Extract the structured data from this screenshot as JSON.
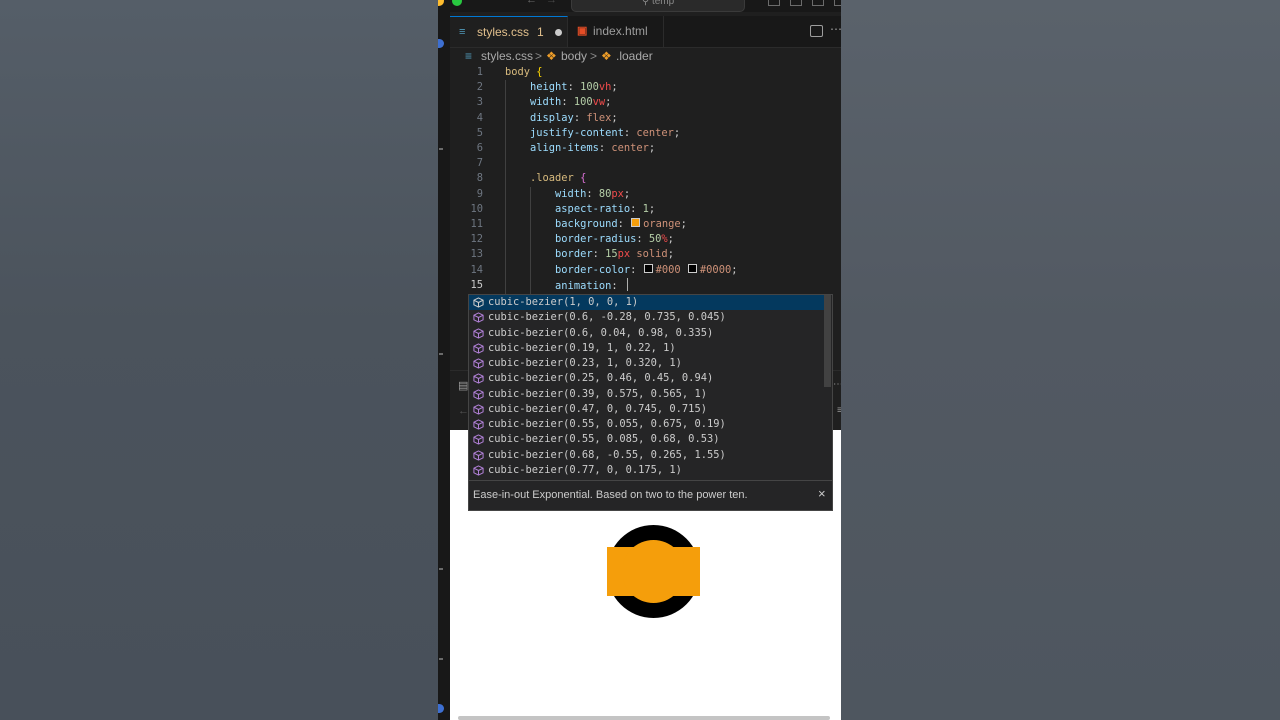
{
  "window": {
    "title_search": "temp"
  },
  "tabs": [
    {
      "label": "styles.css",
      "badge": "1",
      "icon": "css-file-icon",
      "modified": true
    },
    {
      "label": "index.html",
      "icon": "html-file-icon",
      "modified": false
    }
  ],
  "breadcrumb": {
    "file": "styles.css",
    "sep1": ">",
    "sym1": "body",
    "sep2": ">",
    "sym2": ".loader"
  },
  "editor": {
    "lines": [
      {
        "n": "1",
        "tokens": [
          {
            "t": "body ",
            "c": "#d7ba7d"
          },
          {
            "t": "{",
            "c": "#ffd700"
          }
        ]
      },
      {
        "n": "2",
        "tokens": [
          {
            "t": "    height",
            "c": "#9cdcfe"
          },
          {
            "t": ": ",
            "c": "#cccccc"
          },
          {
            "t": "100",
            "c": "#b5cea8"
          },
          {
            "t": "vh",
            "c": "#f14c4c"
          },
          {
            "t": ";",
            "c": "#cccccc"
          }
        ]
      },
      {
        "n": "3",
        "tokens": [
          {
            "t": "    width",
            "c": "#9cdcfe"
          },
          {
            "t": ": ",
            "c": "#cccccc"
          },
          {
            "t": "100",
            "c": "#b5cea8"
          },
          {
            "t": "vw",
            "c": "#f14c4c"
          },
          {
            "t": ";",
            "c": "#cccccc"
          }
        ]
      },
      {
        "n": "4",
        "tokens": [
          {
            "t": "    display",
            "c": "#9cdcfe"
          },
          {
            "t": ": ",
            "c": "#cccccc"
          },
          {
            "t": "flex",
            "c": "#ce9178"
          },
          {
            "t": ";",
            "c": "#cccccc"
          }
        ]
      },
      {
        "n": "5",
        "tokens": [
          {
            "t": "    justify-content",
            "c": "#9cdcfe"
          },
          {
            "t": ": ",
            "c": "#cccccc"
          },
          {
            "t": "center",
            "c": "#ce9178"
          },
          {
            "t": ";",
            "c": "#cccccc"
          }
        ]
      },
      {
        "n": "6",
        "tokens": [
          {
            "t": "    align-items",
            "c": "#9cdcfe"
          },
          {
            "t": ": ",
            "c": "#cccccc"
          },
          {
            "t": "center",
            "c": "#ce9178"
          },
          {
            "t": ";",
            "c": "#cccccc"
          }
        ]
      },
      {
        "n": "7",
        "tokens": []
      },
      {
        "n": "8",
        "tokens": [
          {
            "t": "    .loader ",
            "c": "#d7ba7d"
          },
          {
            "t": "{",
            "c": "#da70d6"
          }
        ]
      },
      {
        "n": "9",
        "tokens": [
          {
            "t": "        width",
            "c": "#9cdcfe"
          },
          {
            "t": ": ",
            "c": "#cccccc"
          },
          {
            "t": "80",
            "c": "#b5cea8"
          },
          {
            "t": "px",
            "c": "#f14c4c"
          },
          {
            "t": ";",
            "c": "#cccccc"
          }
        ]
      },
      {
        "n": "10",
        "tokens": [
          {
            "t": "        aspect-ratio",
            "c": "#9cdcfe"
          },
          {
            "t": ": ",
            "c": "#cccccc"
          },
          {
            "t": "1",
            "c": "#b5cea8"
          },
          {
            "t": ";",
            "c": "#cccccc"
          }
        ]
      },
      {
        "n": "11",
        "tokens": [
          {
            "t": "        background",
            "c": "#9cdcfe"
          },
          {
            "t": ": ",
            "c": "#cccccc"
          },
          {
            "swatch": "#f59e0b"
          },
          {
            "t": "orange",
            "c": "#ce9178"
          },
          {
            "t": ";",
            "c": "#cccccc"
          }
        ]
      },
      {
        "n": "12",
        "tokens": [
          {
            "t": "        border-radius",
            "c": "#9cdcfe"
          },
          {
            "t": ": ",
            "c": "#cccccc"
          },
          {
            "t": "50",
            "c": "#b5cea8"
          },
          {
            "t": "%",
            "c": "#f14c4c"
          },
          {
            "t": ";",
            "c": "#cccccc"
          }
        ]
      },
      {
        "n": "13",
        "tokens": [
          {
            "t": "        border",
            "c": "#9cdcfe"
          },
          {
            "t": ": ",
            "c": "#cccccc"
          },
          {
            "t": "15",
            "c": "#b5cea8"
          },
          {
            "t": "px",
            "c": "#f14c4c"
          },
          {
            "t": " solid",
            "c": "#ce9178"
          },
          {
            "t": ";",
            "c": "#cccccc"
          }
        ]
      },
      {
        "n": "14",
        "tokens": [
          {
            "t": "        border-color",
            "c": "#9cdcfe"
          },
          {
            "t": ": ",
            "c": "#cccccc"
          },
          {
            "swatch": "#000000"
          },
          {
            "t": "#000 ",
            "c": "#ce9178"
          },
          {
            "swatch": "#000000"
          },
          {
            "t": "#0000",
            "c": "#ce9178"
          },
          {
            "t": ";",
            "c": "#cccccc"
          }
        ]
      },
      {
        "n": "15",
        "tokens": [
          {
            "t": "        animation",
            "c": "#9cdcfe"
          },
          {
            "t": ": ",
            "c": "#cccccc"
          }
        ],
        "cursor": true
      }
    ]
  },
  "suggestions": {
    "items": [
      "cubic-bezier(1, 0, 0, 1)",
      "cubic-bezier(0.6, -0.28, 0.735, 0.045)",
      "cubic-bezier(0.6, 0.04, 0.98, 0.335)",
      "cubic-bezier(0.19, 1, 0.22, 1)",
      "cubic-bezier(0.23, 1, 0.320, 1)",
      "cubic-bezier(0.25, 0.46, 0.45, 0.94)",
      "cubic-bezier(0.39, 0.575, 0.565, 1)",
      "cubic-bezier(0.47, 0, 0.745, 0.715)",
      "cubic-bezier(0.55, 0.055, 0.675, 0.19)",
      "cubic-bezier(0.55, 0.085, 0.68, 0.53)",
      "cubic-bezier(0.68, -0.55, 0.265, 1.55)",
      "cubic-bezier(0.77, 0, 0.175, 1)"
    ],
    "detail": "Ease-in-out Exponential. Based on two to the power ten.",
    "close": "×"
  },
  "colors": {
    "accent": "#0078d4",
    "modified_tab": "#e2c08d",
    "loader_fill": "#f59e0b",
    "loader_border": "#000000",
    "suggest_icon": "#b180d7"
  }
}
